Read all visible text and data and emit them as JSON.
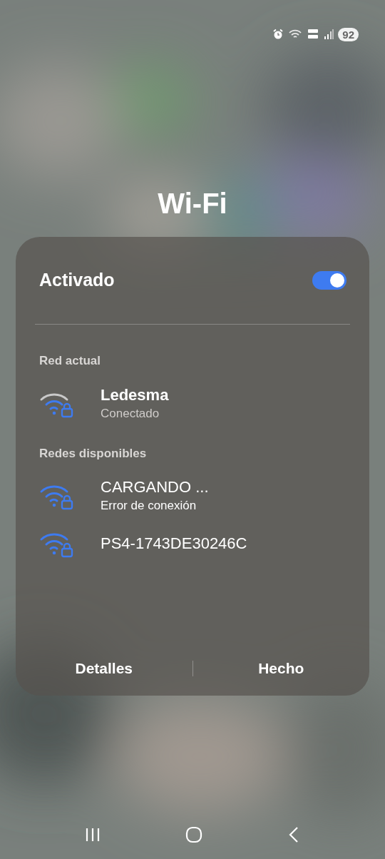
{
  "status_bar": {
    "battery": "92"
  },
  "title": "Wi-Fi",
  "wifi_toggle": {
    "label": "Activado",
    "on": true
  },
  "current_network": {
    "heading": "Red actual",
    "networks": [
      {
        "kind": "connected",
        "name": "Ledesma",
        "status": "Conectado"
      }
    ]
  },
  "available_networks": {
    "heading": "Redes disponibles",
    "networks": [
      {
        "kind": "available",
        "name": "CARGANDO ...",
        "status": "Error de conexión"
      },
      {
        "kind": "available",
        "name": "PS4-1743DE30246C"
      }
    ]
  },
  "buttons": [
    "Detalles",
    "Hecho"
  ]
}
